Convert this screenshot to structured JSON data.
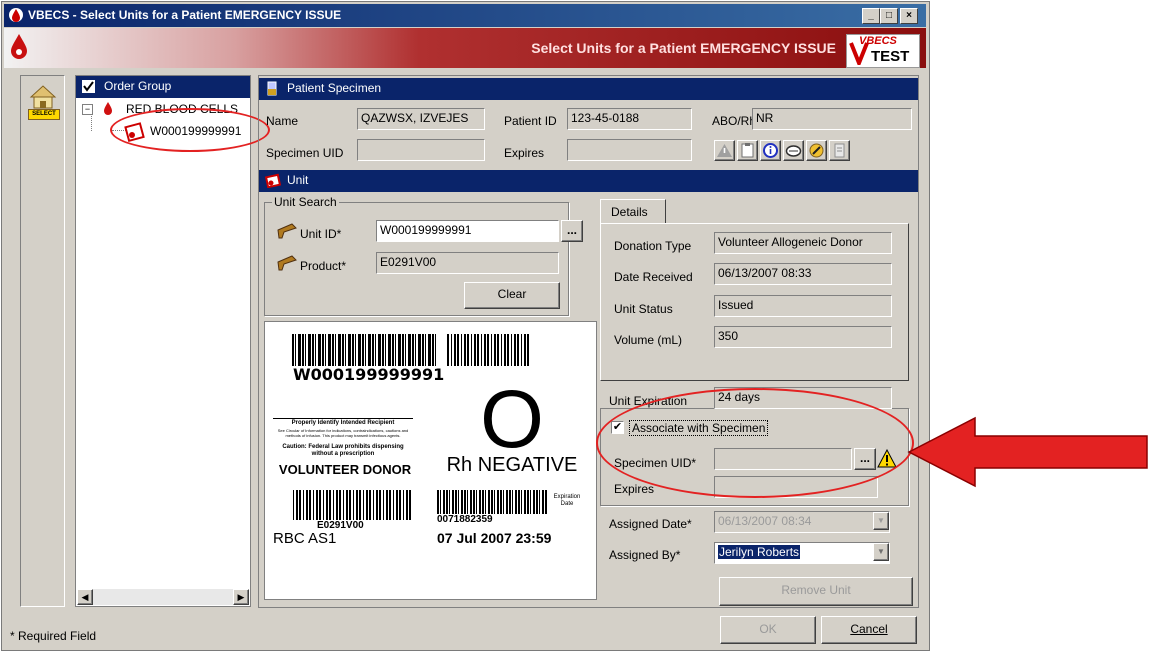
{
  "window": {
    "title": "VBECS - Select Units for a Patient EMERGENCY ISSUE",
    "banner_title": "Select Units for a Patient EMERGENCY ISSUE",
    "logo_top": "VBECS",
    "logo_bottom": "TEST",
    "controls": {
      "minimize": "_",
      "maximize": "□",
      "close": "×"
    }
  },
  "sidebar": {
    "icon_label": "SELECT"
  },
  "tree": {
    "header": "Order Group",
    "root": "RED BLOOD CELLS",
    "child": "W000199999991"
  },
  "patient_specimen": {
    "header": "Patient Specimen",
    "name_label": "Name",
    "name_value": "QAZWSX, IZVEJES",
    "patient_id_label": "Patient ID",
    "patient_id_value": "123-45-0188",
    "aborh_label": "ABO/Rh",
    "aborh_value": "NR",
    "specimen_uid_label": "Specimen UID",
    "specimen_uid_value": "",
    "expires_label": "Expires",
    "expires_value": ""
  },
  "unit": {
    "header": "Unit",
    "search_title": "Unit Search",
    "unit_id_label": "Unit ID*",
    "unit_id_value": "W000199999991",
    "product_label": "Product*",
    "product_value": "E0291V00",
    "browse": "...",
    "clear": "Clear"
  },
  "label_image": {
    "unit_number": "W000199999991",
    "abo": "O",
    "rh": "Rh NEGATIVE",
    "recipient_title": "Properly Identify Intended Recipient",
    "recipient_fine": "See Circular of Information for indications, contraindications, cautions and methods of infusion. This product may transmit infectious agents.",
    "caution": "Caution: Federal Law prohibits dispensing without a prescription",
    "donor": "VOLUNTEER DONOR",
    "product_code": "E0291V00",
    "product_desc": "RBC AS1",
    "exp_code": "0071882359",
    "exp_label": "Expiration Date",
    "exp_date": "07 Jul 2007 23:59"
  },
  "details": {
    "tab": "Details",
    "donation_type_label": "Donation Type",
    "donation_type_value": "Volunteer Allogeneic Donor",
    "date_received_label": "Date Received",
    "date_received_value": "06/13/2007 08:33",
    "unit_status_label": "Unit Status",
    "unit_status_value": "Issued",
    "volume_label": "Volume (mL)",
    "volume_value": "350"
  },
  "association": {
    "unit_expiration_label": "Unit Expiration",
    "unit_expiration_value": "24 days",
    "associate_label": "Associate with Specimen",
    "associate_checked": "✔",
    "specimen_uid_label": "Specimen UID*",
    "specimen_uid_value": "",
    "expires_label": "Expires",
    "expires_value": ""
  },
  "assignment": {
    "assigned_date_label": "Assigned Date*",
    "assigned_date_value": "06/13/2007 08:34",
    "assigned_by_label": "Assigned By*",
    "assigned_by_value": "Jerilyn Roberts",
    "remove_unit": "Remove Unit"
  },
  "footer": {
    "required_note": "* Required Field",
    "ok": "OK",
    "cancel": "Cancel"
  },
  "colors": {
    "title_bar": "#0a246a",
    "annotation": "#e32222",
    "banner": "#8a0e0e"
  }
}
